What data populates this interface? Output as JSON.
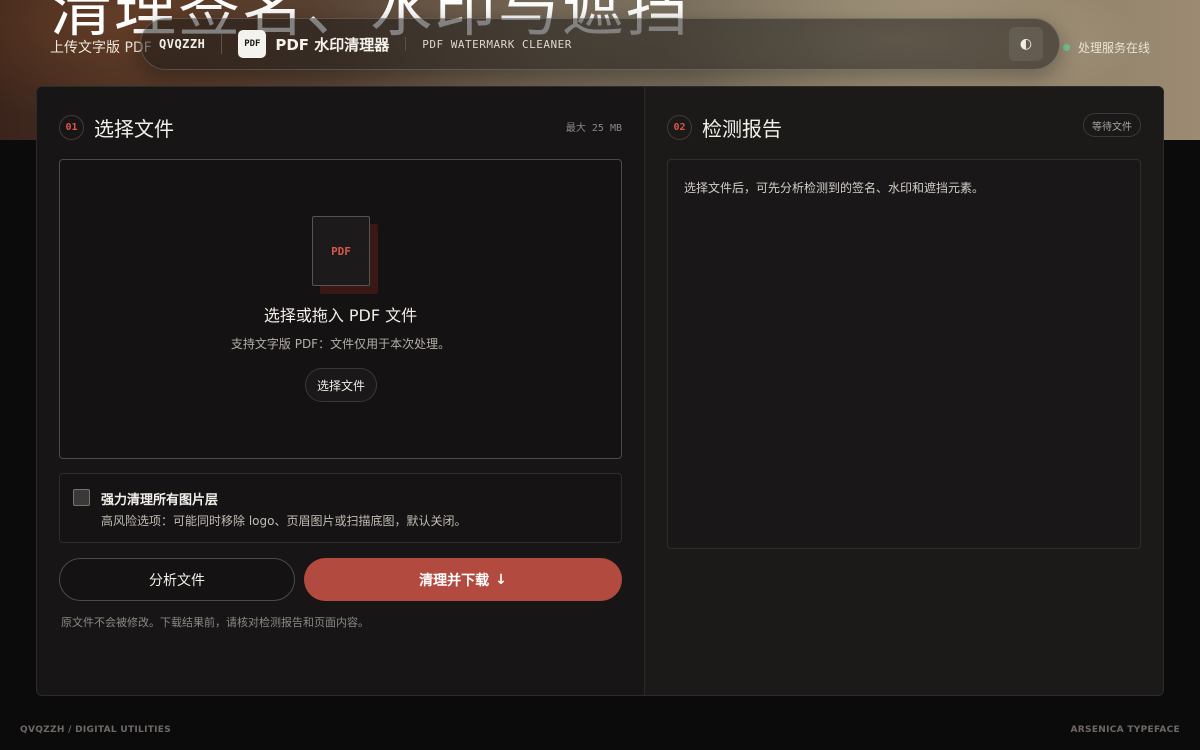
{
  "hero": {
    "title": "清理签名、水印与遮挡",
    "subtitle": "上传文字版 PDF",
    "status": "处理服务在线"
  },
  "nav": {
    "brand": "QVQZZH",
    "logo": "PDF",
    "app_name": "PDF 水印清理器",
    "app_name_en": "PDF WATERMARK CLEANER",
    "theme_icon": "◐"
  },
  "left": {
    "step": "01",
    "title": "选择文件",
    "max_size": "最大 25 MB",
    "dropzone": {
      "file_icon_label": "PDF",
      "title": "选择或拖入 PDF 文件",
      "hint": "支持文字版 PDF：文件仅用于本次处理。",
      "button": "选择文件"
    },
    "option": {
      "checked": false,
      "title": "强力清理所有图片层",
      "desc": "高风险选项：可能同时移除 logo、页眉图片或扫描底图，默认关闭。"
    },
    "analyze_button": "分析文件",
    "clean_button": "清理并下载",
    "clean_icon": "↓",
    "note": "原文件不会被修改。下载结果前，请核对检测报告和页面内容。"
  },
  "right": {
    "step": "02",
    "title": "检测报告",
    "badge": "等待文件",
    "placeholder": "选择文件后，可先分析检测到的签名、水印和遮挡元素。"
  },
  "footer": {
    "left": "QVQZZH / DIGITAL UTILITIES",
    "right": "ARSENICA TYPEFACE"
  },
  "colors": {
    "accent": "#b34a3f",
    "step_number": "#d9574a",
    "status_online": "#6fc79a",
    "background": "#0c0b0b"
  }
}
